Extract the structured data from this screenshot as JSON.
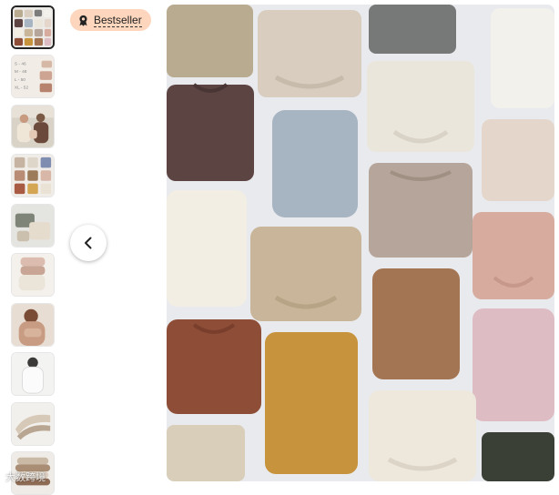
{
  "badge": {
    "label": "Bestseller",
    "icon": "award-ribbon-icon",
    "bg_color": "#fdd6bd"
  },
  "nav": {
    "prev_icon": "chevron-left-icon"
  },
  "thumbnails": [
    {
      "name": "thumb-1",
      "selected": true
    },
    {
      "name": "thumb-2",
      "selected": false
    },
    {
      "name": "thumb-3",
      "selected": false
    },
    {
      "name": "thumb-4",
      "selected": false
    },
    {
      "name": "thumb-5",
      "selected": false
    },
    {
      "name": "thumb-6",
      "selected": false
    },
    {
      "name": "thumb-7",
      "selected": false
    },
    {
      "name": "thumb-8",
      "selected": false
    },
    {
      "name": "thumb-9",
      "selected": false
    },
    {
      "name": "thumb-10",
      "selected": false
    }
  ],
  "thumb_text": {
    "lines": [
      "S - 46",
      "M - 48",
      "L - 50",
      "XL - 52"
    ]
  },
  "watermark": "大数跨境",
  "main_image": {
    "subject": "flat-lay of chunky knit sweaters",
    "colors": [
      "#b9ab8f",
      "#d8cdbf",
      "#777878",
      "#f3f1ec",
      "#5c4443",
      "#a7b4c2",
      "#ebe6dc",
      "#e5d6cb",
      "#b6a59a",
      "#d7ab9e",
      "#f2eee4",
      "#c9b69a",
      "#a37553",
      "#8d4d37",
      "#c7933d",
      "#ddbcc4",
      "#ede7dc",
      "#3b4036"
    ]
  }
}
